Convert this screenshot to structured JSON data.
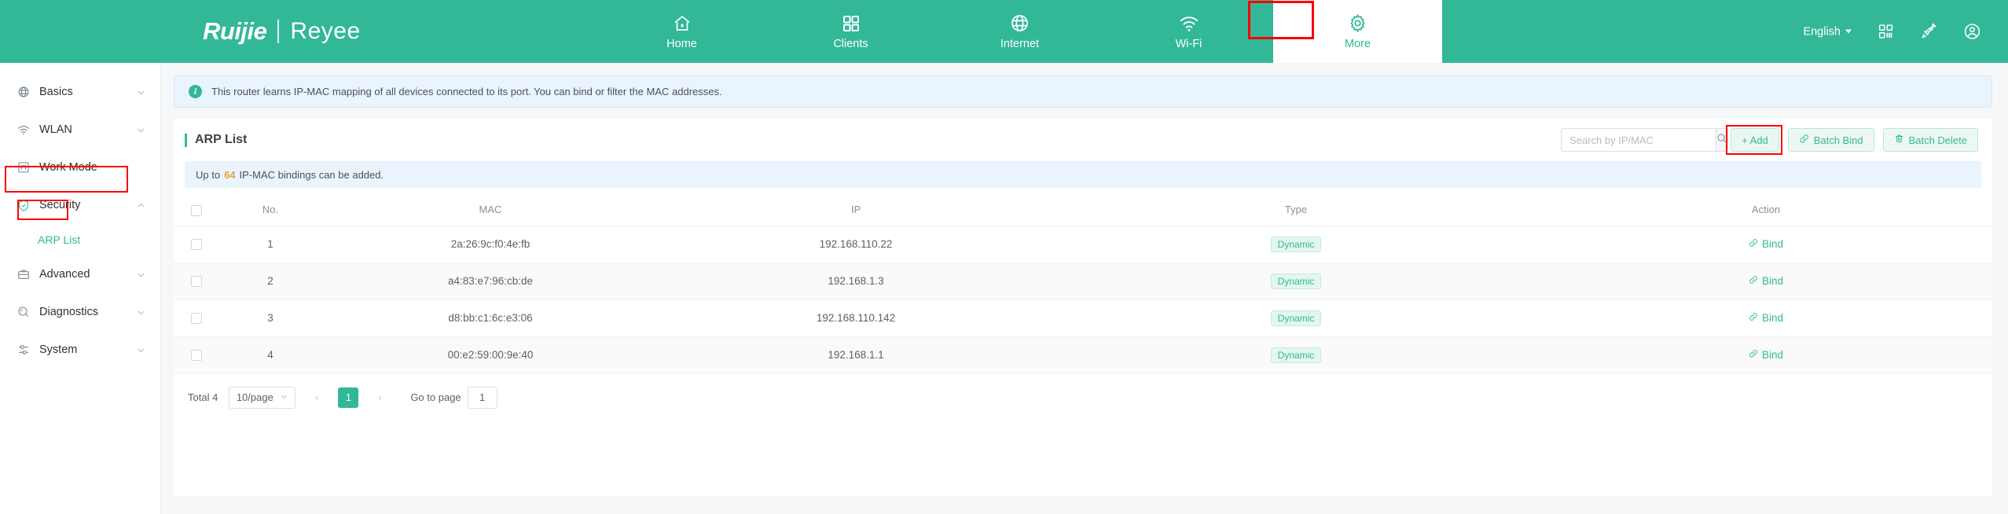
{
  "theme": {
    "accent": "#32b897",
    "accent_light": "#e9f7f3",
    "info_bg": "#eaf4fd",
    "warn": "#e6a23c",
    "annotation": "#ff0000"
  },
  "header": {
    "brand_primary": "Ruijie",
    "brand_secondary": "Reyee",
    "nav": [
      {
        "label": "Home",
        "icon": "home-icon",
        "active": false
      },
      {
        "label": "Clients",
        "icon": "grid-icon",
        "active": false
      },
      {
        "label": "Internet",
        "icon": "globe-icon",
        "active": false
      },
      {
        "label": "Wi-Fi",
        "icon": "wifi-icon",
        "active": false
      },
      {
        "label": "More",
        "icon": "gear-icon",
        "active": true
      }
    ],
    "language": "English",
    "icons": [
      "qrcode-icon",
      "rocket-icon",
      "user-account-icon"
    ]
  },
  "sidebar": {
    "items": [
      {
        "label": "Basics",
        "icon": "globe-icon",
        "expandable": true
      },
      {
        "label": "WLAN",
        "icon": "wifi-icon",
        "expandable": true
      },
      {
        "label": "Work Mode",
        "icon": "workmode-icon",
        "expandable": false
      },
      {
        "label": "Security",
        "icon": "shield-check-icon",
        "expandable": true,
        "expanded": true
      },
      {
        "label": "Advanced",
        "icon": "briefcase-icon",
        "expandable": true
      },
      {
        "label": "Diagnostics",
        "icon": "diagnostics-icon",
        "expandable": true
      },
      {
        "label": "System",
        "icon": "sliders-icon",
        "expandable": true
      }
    ],
    "sub_item": {
      "label": "ARP List",
      "active": true
    }
  },
  "banner": {
    "text": "This router learns IP-MAC mapping of all devices connected to its port. You can bind or filter the MAC addresses."
  },
  "card": {
    "title": "ARP List",
    "search": {
      "placeholder": "Search by IP/MAC",
      "value": ""
    },
    "buttons": {
      "add": "+ Add",
      "batch_bind": "Batch Bind",
      "batch_delete": "Batch Delete"
    },
    "notice": {
      "prefix": "Up to",
      "count": "64",
      "suffix": "IP-MAC bindings can be added."
    }
  },
  "table": {
    "columns": [
      "No.",
      "MAC",
      "IP",
      "Type",
      "Action"
    ],
    "rows": [
      {
        "no": "1",
        "mac": "2a:26:9c:f0:4e:fb",
        "ip": "192.168.110.22",
        "type": "Dynamic",
        "action": "Bind"
      },
      {
        "no": "2",
        "mac": "a4:83:e7:96:cb:de",
        "ip": "192.168.1.3",
        "type": "Dynamic",
        "action": "Bind"
      },
      {
        "no": "3",
        "mac": "d8:bb:c1:6c:e3:06",
        "ip": "192.168.110.142",
        "type": "Dynamic",
        "action": "Bind"
      },
      {
        "no": "4",
        "mac": "00:e2:59:00:9e:40",
        "ip": "192.168.1.1",
        "type": "Dynamic",
        "action": "Bind"
      }
    ]
  },
  "pagination": {
    "total": "Total 4",
    "page_size": "10/page",
    "prev": "‹",
    "next": "›",
    "current_page": "1",
    "goto_label": "Go to page",
    "goto_value": "1"
  }
}
